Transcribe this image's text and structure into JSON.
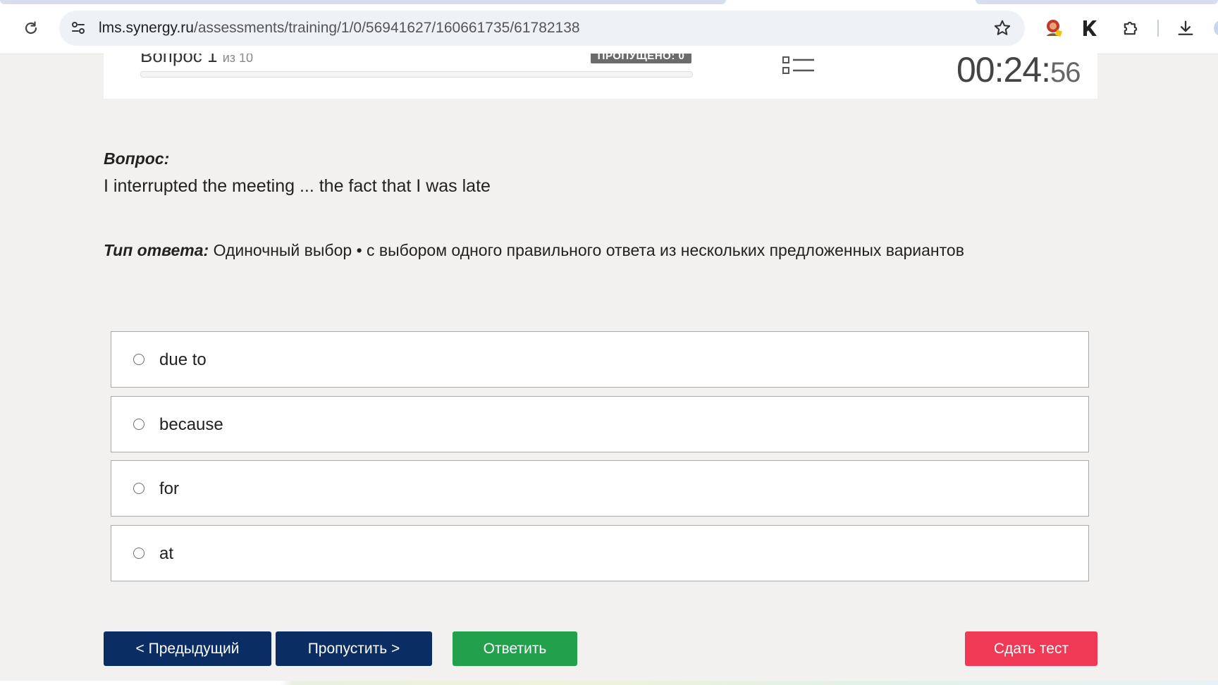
{
  "browser": {
    "url_host": "lms.synergy.ru",
    "url_path": "/assessments/training/1/0/56941627/160661735/61782138",
    "icons": {
      "reload": "reload-icon",
      "site_settings": "tune-icon",
      "bookmark": "star-icon",
      "extensions": [
        "profile-avatar-extension-icon",
        "kaspersky-extension-icon",
        "puzzle-extensions-icon",
        "download-icon"
      ]
    }
  },
  "header": {
    "question_counter": "Вопрос 1",
    "question_of": "из 10",
    "skipped_badge": "ПРОПУЩЕНО: 0",
    "timer_main": "00:24:",
    "timer_seconds": "56",
    "list_icon": "question-list-icon"
  },
  "question": {
    "label": "Вопрос:",
    "text": "I interrupted the meeting ... the fact that I was late",
    "answer_type_label": "Тип ответа:",
    "answer_type_value": "Одиночный выбор • с выбором одного правильного ответа из нескольких предложенных вариантов"
  },
  "options": [
    {
      "label": "due to",
      "selected": false
    },
    {
      "label": "because",
      "selected": false
    },
    {
      "label": "for",
      "selected": false
    },
    {
      "label": "at",
      "selected": false
    }
  ],
  "buttons": {
    "prev": "< Предыдущий",
    "skip": "Пропустить >",
    "answer": "Ответить",
    "submit": "Сдать тест"
  },
  "colors": {
    "nav_button": "#0a2d63",
    "answer_button": "#22a04b",
    "submit_button": "#f03a55",
    "page_background": "#f2f1ef"
  }
}
